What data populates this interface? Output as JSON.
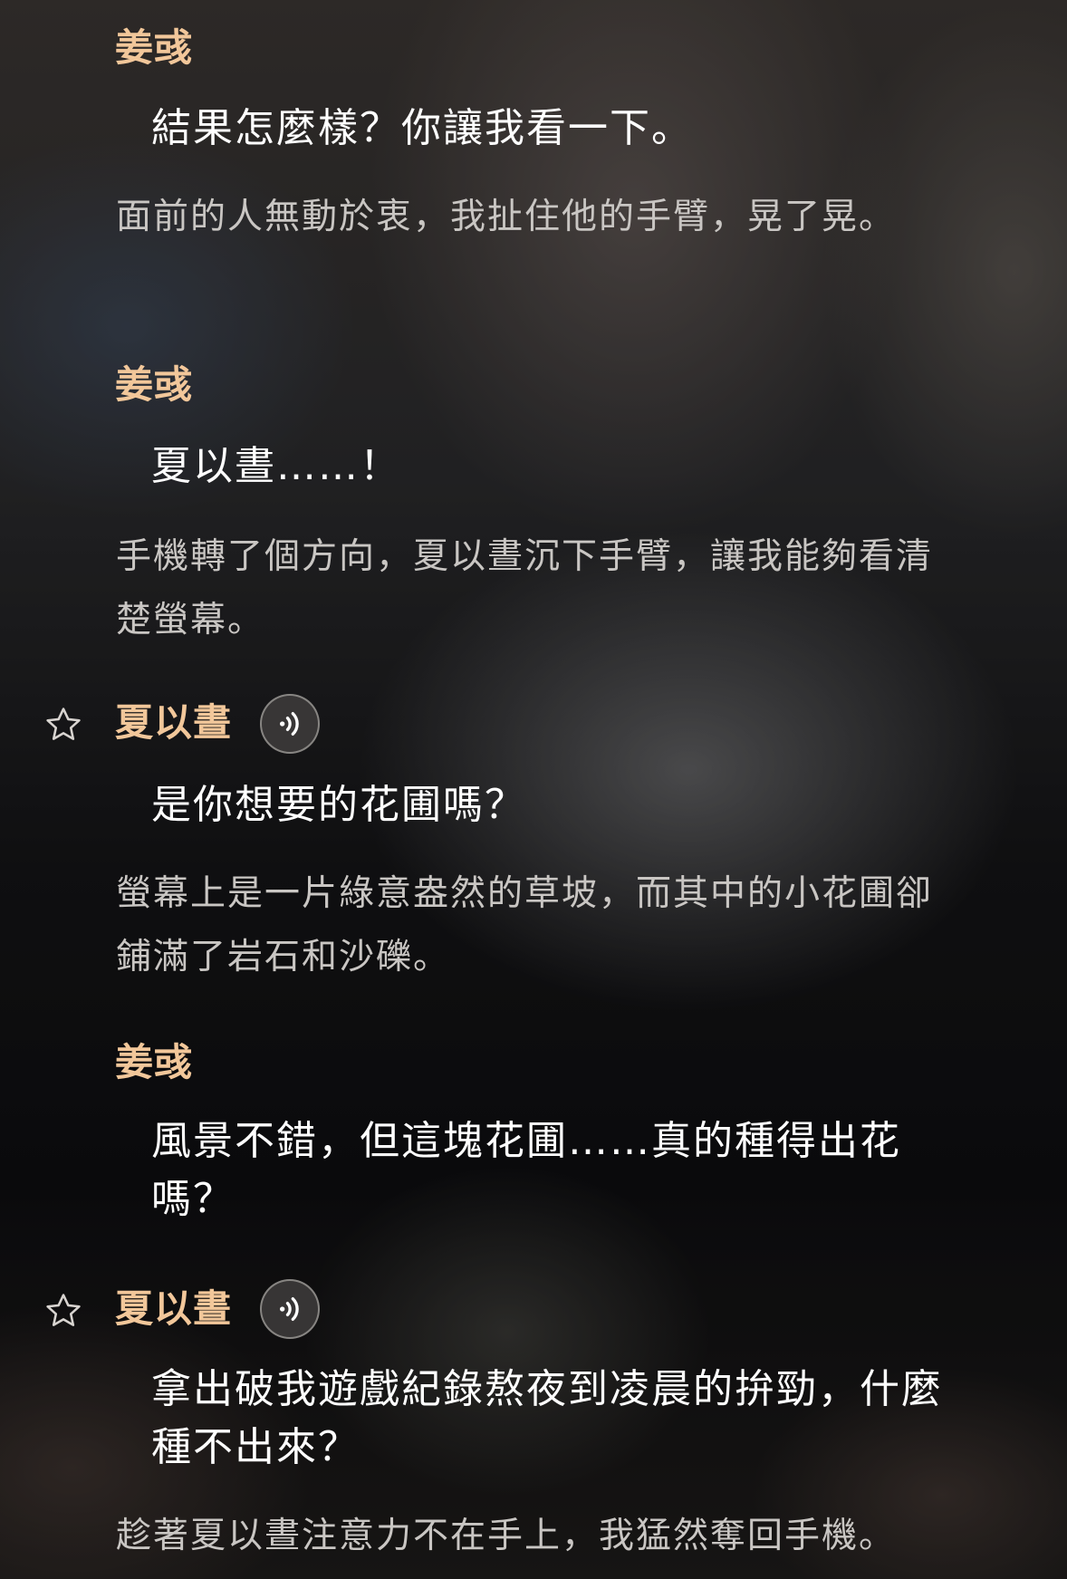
{
  "blocks": [
    {
      "speaker": "姜彧",
      "line": "結果怎麼樣？你讓我看一下。",
      "narration": "面前的人無動於衷，我扯住他的手臂，晃了晃。"
    },
    {
      "speaker": "姜彧",
      "line": "夏以晝……！",
      "narration": "手機轉了個方向，夏以晝沉下手臂，讓我能夠看清楚螢幕。"
    },
    {
      "speaker": "夏以晝",
      "line": "是你想要的花圃嗎？",
      "narration": "螢幕上是一片綠意盎然的草坡，而其中的小花圃卻鋪滿了岩石和沙礫。"
    },
    {
      "speaker": "姜彧",
      "line": "風景不錯，但這塊花圃……真的種得出花嗎？"
    },
    {
      "speaker": "夏以晝",
      "line": "拿出破我遊戲紀錄熬夜到凌晨的拚勁，什麼種不出來？",
      "narration": "趁著夏以晝注意力不在手上，我猛然奪回手機。"
    }
  ],
  "icons": {
    "star": "star-outline-icon",
    "voice": "voice-play-icon"
  },
  "colors": {
    "speaker": "#f2c79a",
    "line": "#ffffff",
    "narration": "#c9c6c3"
  }
}
